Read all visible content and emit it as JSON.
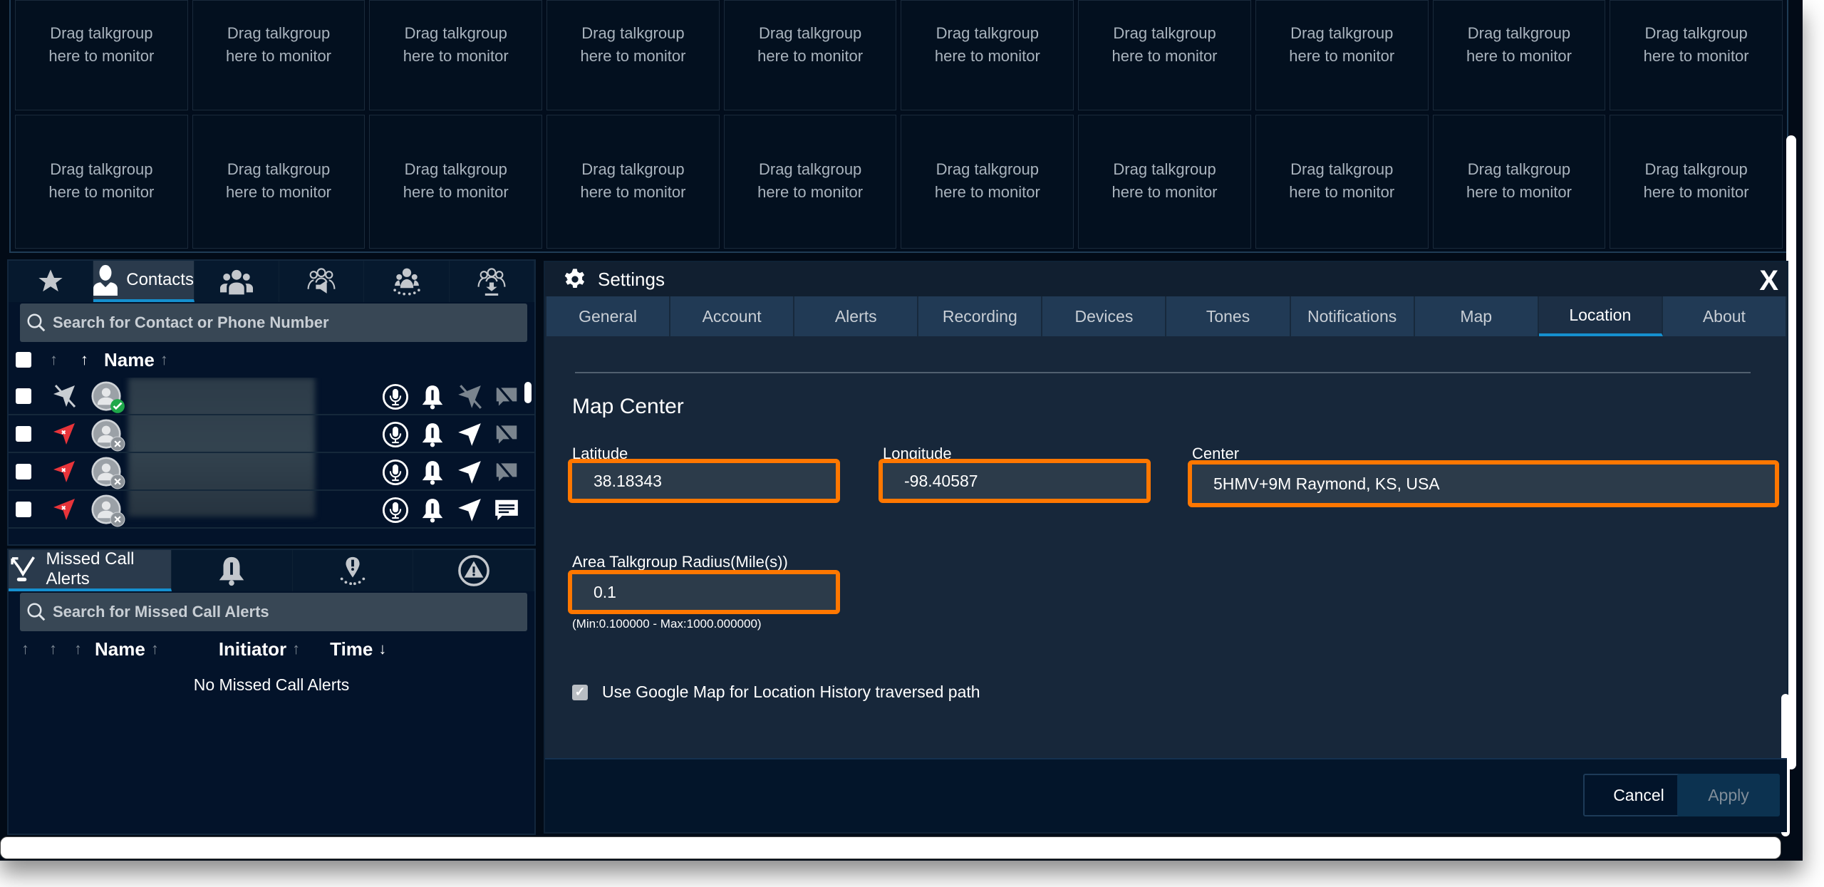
{
  "monitor_grid": {
    "cell_text_line1": "Drag talkgroup",
    "cell_text_line2": "here to monitor",
    "rows": 2,
    "columns": 10
  },
  "contacts_panel": {
    "tabs": [
      {
        "icon": "star-icon",
        "label": ""
      },
      {
        "icon": "person-icon",
        "label": "Contacts",
        "active": true
      },
      {
        "icon": "group-icon",
        "label": ""
      },
      {
        "icon": "broadcast-group-icon",
        "label": ""
      },
      {
        "icon": "area-group-icon",
        "label": ""
      },
      {
        "icon": "download-group-icon",
        "label": ""
      }
    ],
    "search_placeholder": "Search for Contact or Phone Number",
    "header": {
      "sort_arrow": "↑",
      "name_label": "Name"
    },
    "rows": [
      {
        "location_status": "location-disabled",
        "presence": "online",
        "name": "",
        "location_action": "disabled",
        "message": "disabled"
      },
      {
        "location_status": "location-unavailable",
        "presence": "offline",
        "name": "",
        "location_action": "enabled",
        "message": "disabled"
      },
      {
        "location_status": "location-unavailable",
        "presence": "offline",
        "name": "",
        "location_action": "enabled",
        "message": "disabled"
      },
      {
        "location_status": "location-unavailable",
        "presence": "offline",
        "name": "",
        "location_action": "enabled",
        "message": "enabled"
      }
    ]
  },
  "missed_panel": {
    "tabs": [
      {
        "icon": "missed-call-icon",
        "label": "Missed Call Alerts",
        "active": true
      },
      {
        "icon": "bell-icon",
        "label": ""
      },
      {
        "icon": "geofence-icon",
        "label": ""
      },
      {
        "icon": "emergency-icon",
        "label": ""
      }
    ],
    "search_placeholder": "Search for Missed Call Alerts",
    "columns": [
      {
        "label": "Name",
        "sort": "↑"
      },
      {
        "label": "Initiator",
        "sort": "↑"
      },
      {
        "label": "Time",
        "sort": "↓"
      }
    ],
    "empty_message": "No Missed Call Alerts"
  },
  "settings": {
    "title": "Settings",
    "close_label": "X",
    "tabs": [
      "General",
      "Account",
      "Alerts",
      "Recording",
      "Devices",
      "Tones",
      "Notifications",
      "Map",
      "Location",
      "About"
    ],
    "active_tab": "Location",
    "section_title": "Map Center",
    "latitude": {
      "label": "Latitude",
      "value": "38.18343"
    },
    "longitude": {
      "label": "Longitude",
      "value": "-98.40587"
    },
    "center": {
      "label": "Center",
      "value": "5HMV+9M Raymond, KS, USA"
    },
    "radius": {
      "label": "Area Talkgroup Radius(Mile(s))",
      "value": "0.1",
      "hint": "(Min:0.100000 - Max:1000.000000)"
    },
    "google_map_checkbox": {
      "label": "Use Google Map for Location History traversed path",
      "checked": true
    },
    "cancel_label": "Cancel",
    "apply_label": "Apply"
  },
  "colors": {
    "highlight": "#ff7700",
    "accent": "#1590cf",
    "background": "#020b17"
  }
}
